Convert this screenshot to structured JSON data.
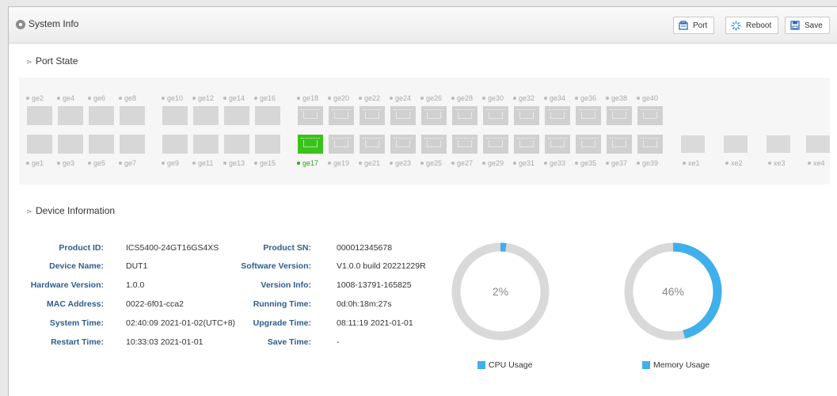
{
  "header": {
    "title": "System Info",
    "buttons": {
      "port": "Port",
      "reboot": "Reboot",
      "save": "Save"
    }
  },
  "port_state": {
    "title": "Port State",
    "top_labels": [
      "ge2",
      "ge4",
      "ge6",
      "ge8",
      "ge10",
      "ge12",
      "ge14",
      "ge16",
      "ge18",
      "ge20",
      "ge22",
      "ge24",
      "ge26",
      "ge28",
      "ge30",
      "ge32",
      "ge34",
      "ge36",
      "ge38",
      "ge40"
    ],
    "bottom_labels": [
      "ge1",
      "ge3",
      "ge5",
      "ge7",
      "ge9",
      "ge11",
      "ge13",
      "ge15",
      "ge17",
      "ge19",
      "ge21",
      "ge23",
      "ge25",
      "ge27",
      "ge29",
      "ge31",
      "ge33",
      "ge35",
      "ge37",
      "ge39"
    ],
    "xe_labels": [
      "xe1",
      "xe2",
      "xe3",
      "xe4"
    ],
    "up_ports": [
      "ge17"
    ]
  },
  "device_info": {
    "title": "Device Information",
    "left": [
      {
        "label": "Product ID:",
        "value": "ICS5400-24GT16GS4XS"
      },
      {
        "label": "Device Name:",
        "value": "DUT1"
      },
      {
        "label": "Hardware Version:",
        "value": "1.0.0"
      },
      {
        "label": "MAC Address:",
        "value": "0022-6f01-cca2"
      },
      {
        "label": "System Time:",
        "value": "02:40:09 2021-01-02(UTC+8)"
      },
      {
        "label": "Restart Time:",
        "value": "10:33:03 2021-01-01"
      }
    ],
    "right": [
      {
        "label": "Product SN:",
        "value": "000012345678"
      },
      {
        "label": "Software Version:",
        "value": "V1.0.0 build 20221229R"
      },
      {
        "label": "Version Info:",
        "value": "1008-13791-165825"
      },
      {
        "label": "Running Time:",
        "value": "0d:0h:18m:27s"
      },
      {
        "label": "Upgrade Time:",
        "value": "08:11:19 2021-01-01"
      },
      {
        "label": "Save Time:",
        "value": "-"
      }
    ]
  },
  "usage": {
    "cpu": {
      "text": "2%",
      "fraction": 0.02,
      "legend": "CPU Usage"
    },
    "memory": {
      "text": "46%",
      "fraction": 0.46,
      "legend": "Memory Usage"
    },
    "colors": {
      "fill": "#3fb0eb",
      "track": "#d9d9d9"
    }
  }
}
